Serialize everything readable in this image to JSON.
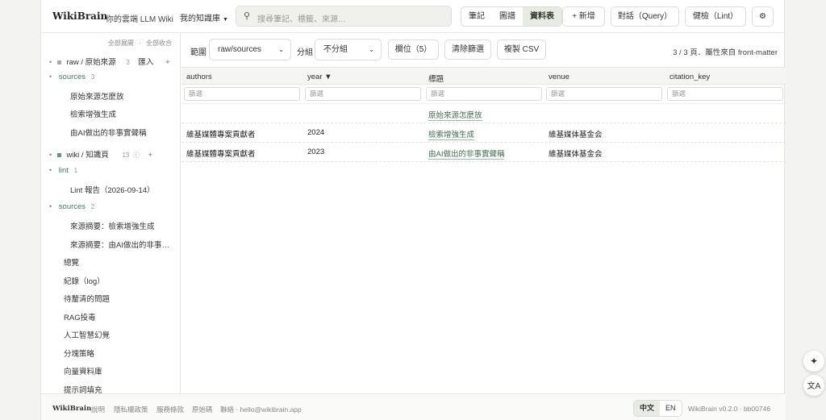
{
  "header": {
    "brand": "WikiBrain",
    "tagline": "你的雲端 LLM Wiki",
    "kb_label": "我的知識庫",
    "search_placeholder": "搜尋筆記、標籤、來源…",
    "view_tabs": [
      "筆記",
      "圖譜",
      "資料表"
    ],
    "active_tab": "資料表",
    "new_label": "+ 新增",
    "chat_label": "對話（Query）",
    "lint_label": "健檢（Lint）",
    "settings_icon": "gear-icon"
  },
  "sidebar": {
    "expand_all": "全部展開",
    "sep": "·",
    "collapse_all": "全部收合",
    "raw": {
      "label": "raw / 原始來源",
      "count": "3",
      "import": "匯入",
      "add": "+",
      "color": "#a0a0a0"
    },
    "raw_sources": {
      "label": "sources",
      "count": "3"
    },
    "raw_items": [
      "原始來源怎麼放",
      "檢索增強生成",
      "由AI做出的非事實聲稱"
    ],
    "wiki": {
      "label": "wiki / 知識頁",
      "count": "13",
      "info": "ⓘ",
      "add": "+",
      "color": "#5f9a78"
    },
    "lint": {
      "label": "lint",
      "count": "1"
    },
    "lint_items": [
      "Lint 報告（2026-09-14）"
    ],
    "wiki_sources": {
      "label": "sources",
      "count": "2"
    },
    "wiki_source_items": [
      "來源摘要：檢索增強生成",
      "來源摘要：由AI做出的非事…"
    ],
    "pages": [
      "總覽",
      "紀錄（log）",
      "待釐清的問題",
      "RAG投毒",
      "人工智慧幻覺",
      "分塊策略",
      "向量資料庫",
      "提示詞填充"
    ]
  },
  "toolbar": {
    "scope_label": "範圍",
    "scope_value": "raw/sources",
    "group_label": "分組",
    "group_value": "不分組",
    "columns_btn": "欄位（5）",
    "clear_btn": "清除篩選",
    "copy_btn": "複製 CSV",
    "page_info": "3 / 3 頁．屬性來自 front-matter"
  },
  "table": {
    "columns": [
      "authors",
      "year ▼",
      "標題",
      "venue",
      "citation_key"
    ],
    "filter_placeholder": "篩選",
    "rows": [
      [
        "",
        "",
        "原始來源怎麼放",
        "",
        ""
      ],
      [
        "維基媒體專案貢獻者",
        "2024",
        "檢索增強生成",
        "維基媒体基金会",
        ""
      ],
      [
        "維基媒體專案貢獻者",
        "2023",
        "由AI做出的非事實聲稱",
        "維基媒体基金会",
        ""
      ]
    ]
  },
  "footer": {
    "brand": "WikiBrain",
    "links": [
      "說明",
      "隱私權政策",
      "服務條款",
      "原始碼",
      "聯絡 · hello@wikibrain.app"
    ],
    "lang": [
      "中文",
      "EN"
    ],
    "active_lang": "中文",
    "version": "WikiBrain v0.2.0 · bb00746"
  },
  "floating": {
    "sparkle_icon": "sparkle-icon",
    "translate_icon": "translate-icon"
  }
}
